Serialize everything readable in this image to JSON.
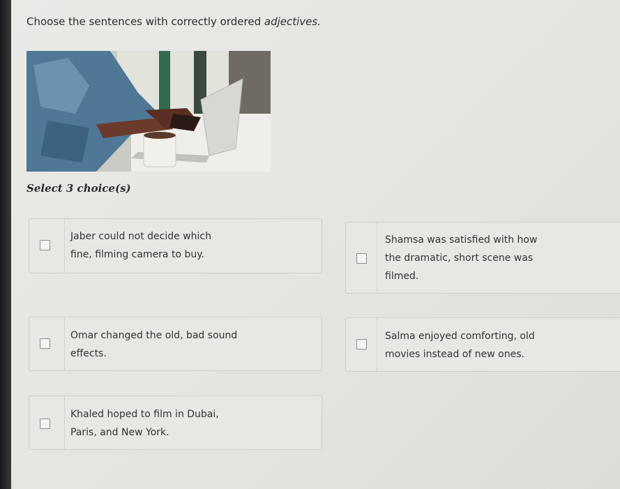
{
  "question": {
    "prefix": "Choose the sentences with correctly ordered ",
    "emphasis": "adjectives."
  },
  "instruction": "Select 3 choice(s)",
  "choices": [
    {
      "line1": "Jaber could not decide which",
      "line2": "fine, filming camera to buy.",
      "line3": ""
    },
    {
      "line1": "Shamsa was satisfied with how",
      "line2": "the dramatic, short scene was",
      "line3": "filmed."
    },
    {
      "line1": "Omar changed the old, bad sound",
      "line2": "effects.",
      "line3": ""
    },
    {
      "line1": "Salma enjoyed comforting, old",
      "line2": "movies instead of new ones.",
      "line3": ""
    },
    {
      "line1": "Khaled hoped to film in Dubai,",
      "line2": "Paris, and New York.",
      "line3": ""
    }
  ]
}
